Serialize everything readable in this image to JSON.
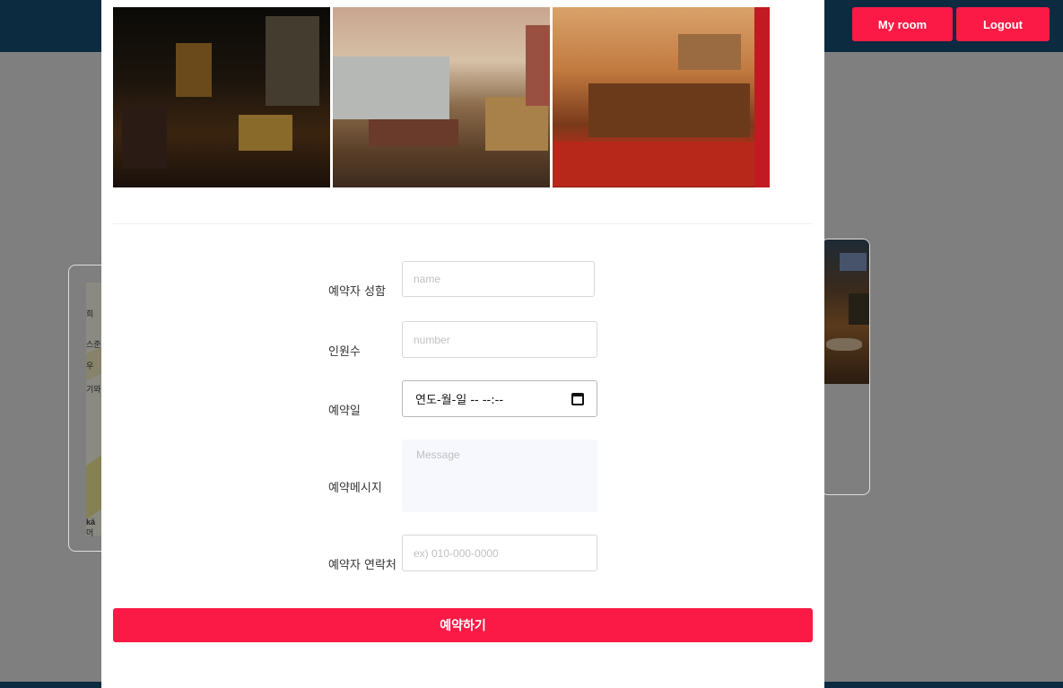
{
  "header": {
    "myroom_label": "My room",
    "logout_label": "Logout"
  },
  "map_labels": [
    "희",
    "스준",
    "우",
    "기와",
    "kā",
    "머"
  ],
  "form": {
    "name_label": "예약자 성함",
    "name_placeholder": "name",
    "people_label": "인원수",
    "people_placeholder": "number",
    "date_label": "예약일",
    "date_value": "연도-월-일 -- --:--",
    "message_label": "예약메시지",
    "message_placeholder": "Message",
    "phone_label": "예약자 연락처",
    "phone_placeholder": "ex) 010-000-0000",
    "submit_label": "예약하기"
  },
  "colors": {
    "accent": "#fb1a45",
    "header_bg": "#0c2a40",
    "overlay": "#7f7f7f"
  }
}
